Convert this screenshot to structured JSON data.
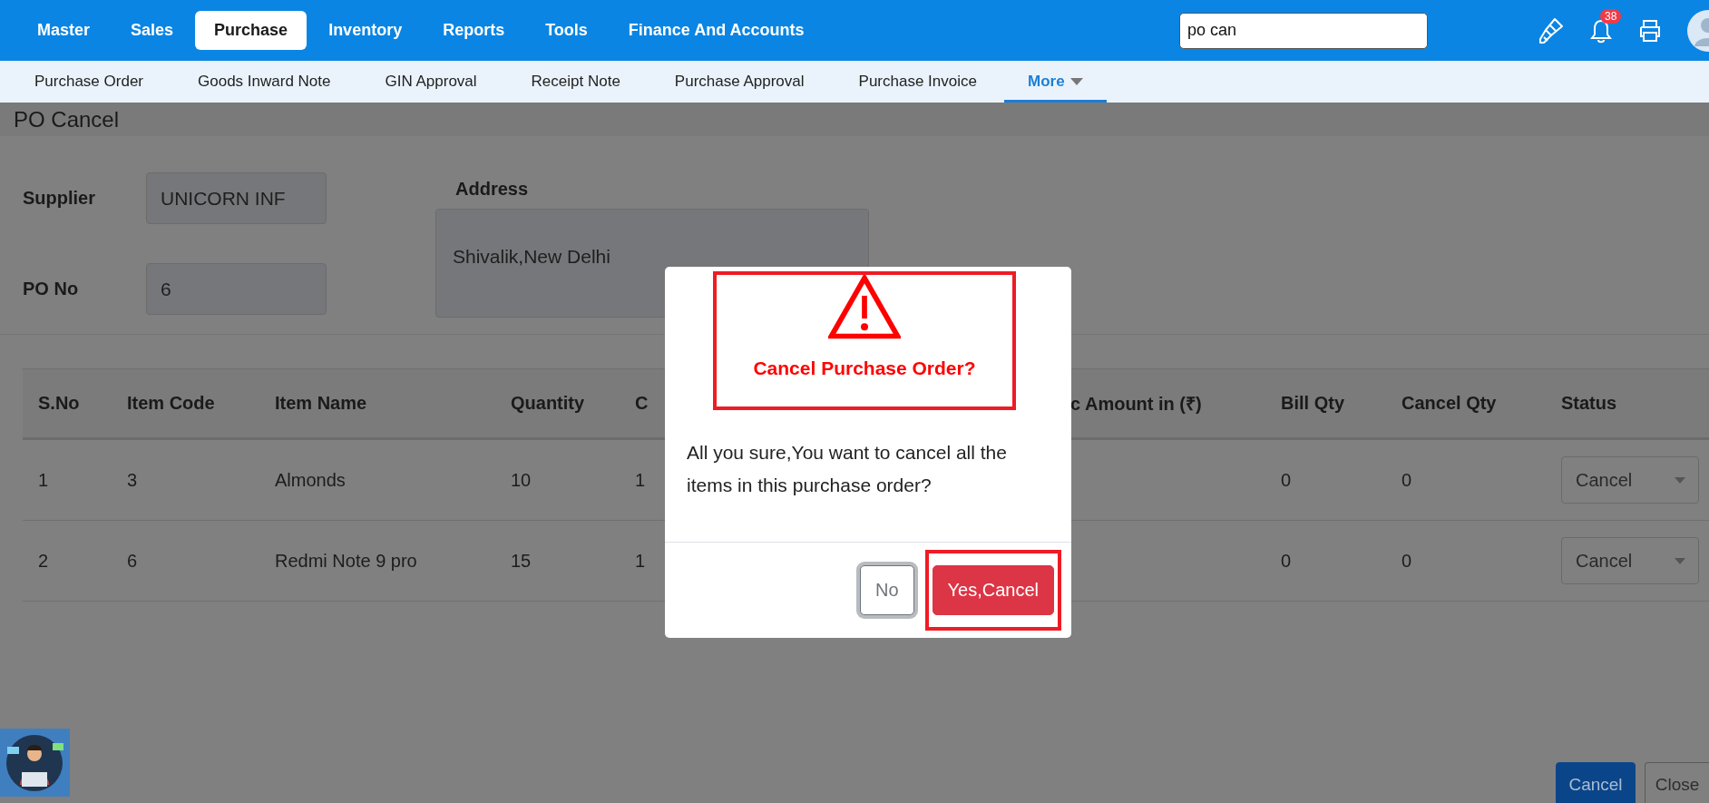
{
  "top_nav": {
    "items": [
      {
        "label": "Master",
        "selected": false
      },
      {
        "label": "Sales",
        "selected": false
      },
      {
        "label": "Purchase",
        "selected": true
      },
      {
        "label": "Inventory",
        "selected": false
      },
      {
        "label": "Reports",
        "selected": false
      },
      {
        "label": "Tools",
        "selected": false
      },
      {
        "label": "Finance And Accounts",
        "selected": false
      }
    ],
    "search": {
      "value": "po can"
    },
    "notification_badge": "38"
  },
  "sub_nav": {
    "items": [
      {
        "label": "Purchase Order",
        "selected": false
      },
      {
        "label": "Goods Inward Note",
        "selected": false
      },
      {
        "label": "GIN Approval",
        "selected": false
      },
      {
        "label": "Receipt Note",
        "selected": false
      },
      {
        "label": "Purchase Approval",
        "selected": false
      },
      {
        "label": "Purchase Invoice",
        "selected": false
      },
      {
        "label": "More",
        "selected": true
      }
    ]
  },
  "page": {
    "title": "PO Cancel",
    "supplier": {
      "label": "Supplier",
      "value": "UNICORN INF"
    },
    "po_no": {
      "label": "PO No",
      "value": "6"
    },
    "address": {
      "label": "Address",
      "value": "Shivalik,New Delhi"
    }
  },
  "table": {
    "columns": [
      "S.No",
      "Item Code",
      "Item Name",
      "Quantity",
      "C",
      "c Amount in (₹)",
      "Bill Qty",
      "Cancel Qty",
      "Status"
    ],
    "rows": [
      {
        "cells": [
          "1",
          "3",
          "Almonds",
          "10",
          "1",
          null,
          "0",
          "0"
        ],
        "status": "Cancel"
      },
      {
        "cells": [
          "2",
          "6",
          "Redmi Note 9 pro",
          "15",
          "1",
          null,
          "0",
          "0"
        ],
        "status": "Cancel"
      }
    ]
  },
  "dialog": {
    "title": "Cancel Purchase Order?",
    "title_highlighted": true,
    "message": "All you sure,You want to cancel all the items in this purchase order?",
    "buttons": [
      {
        "label": "No",
        "kind": "secondary",
        "focused": true,
        "highlighted": false
      },
      {
        "label": "Yes,Cancel",
        "kind": "danger",
        "focused": false,
        "highlighted": true
      }
    ]
  },
  "footer_buttons": [
    {
      "label": "Cancel",
      "kind": "primary"
    },
    {
      "label": "Close",
      "kind": "secondary"
    }
  ]
}
